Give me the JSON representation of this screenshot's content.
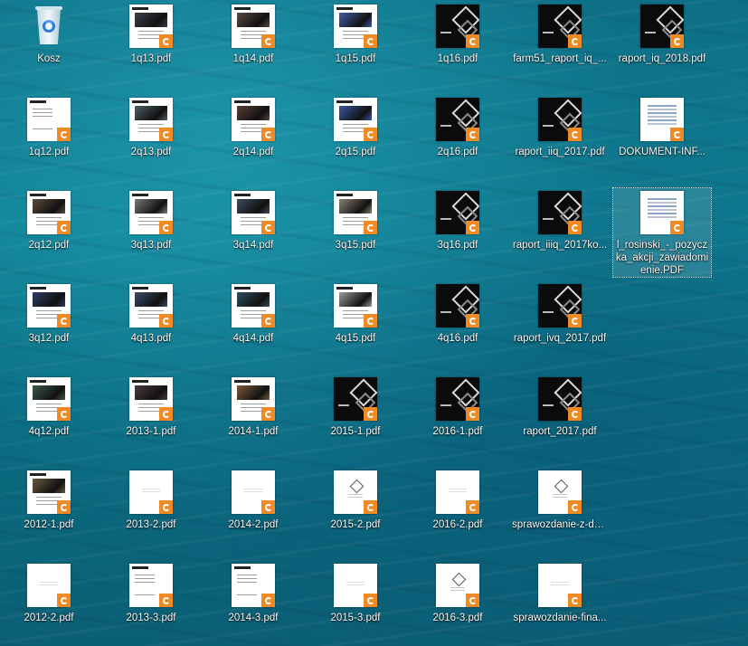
{
  "desktop": {
    "icons": [
      {
        "label": "Kosz",
        "kind": "recycle-bin",
        "col": 0,
        "row": 0
      },
      {
        "label": "1q13.pdf",
        "kind": "photo",
        "tone": "#3a3f4a",
        "col": 1,
        "row": 0
      },
      {
        "label": "1q14.pdf",
        "kind": "photo",
        "tone": "#5a4a42",
        "col": 2,
        "row": 0
      },
      {
        "label": "1q15.pdf",
        "kind": "photo",
        "tone": "#3f5fa8",
        "col": 3,
        "row": 0
      },
      {
        "label": "1q16.pdf",
        "kind": "dark",
        "col": 4,
        "row": 0
      },
      {
        "label": "farm51_raport_iq_...",
        "kind": "dark",
        "col": 5,
        "row": 0
      },
      {
        "label": "raport_iq_2018.pdf",
        "kind": "dark",
        "col": 6,
        "row": 0
      },
      {
        "label": "1q12.pdf",
        "kind": "text",
        "col": 0,
        "row": 1
      },
      {
        "label": "2q13.pdf",
        "kind": "photo",
        "tone": "#4f5e66",
        "col": 1,
        "row": 1
      },
      {
        "label": "2q14.pdf",
        "kind": "photo",
        "tone": "#5b3e36",
        "col": 2,
        "row": 1
      },
      {
        "label": "2q15.pdf",
        "kind": "photo",
        "tone": "#3a56a0",
        "col": 3,
        "row": 1
      },
      {
        "label": "2q16.pdf",
        "kind": "dark",
        "col": 4,
        "row": 1
      },
      {
        "label": "raport_iiq_2017.pdf",
        "kind": "dark",
        "col": 5,
        "row": 1
      },
      {
        "label": "DOKUMENT-INF...",
        "kind": "doc",
        "col": 6,
        "row": 1
      },
      {
        "label": "2q12.pdf",
        "kind": "photo",
        "tone": "#5c4b3a",
        "col": 0,
        "row": 2
      },
      {
        "label": "3q13.pdf",
        "kind": "photo",
        "tone": "#7a7a7a",
        "col": 1,
        "row": 2
      },
      {
        "label": "3q14.pdf",
        "kind": "photo",
        "tone": "#3e4a5a",
        "col": 2,
        "row": 2
      },
      {
        "label": "3q15.pdf",
        "kind": "photo",
        "tone": "#8a8070",
        "col": 3,
        "row": 2
      },
      {
        "label": "3q16.pdf",
        "kind": "dark",
        "col": 4,
        "row": 2
      },
      {
        "label": "raport_iiiq_2017ko...",
        "kind": "dark",
        "col": 5,
        "row": 2
      },
      {
        "label": "l_rosinski_-_pozyczka_akcji_zawiadomienie.PDF",
        "kind": "doc",
        "col": 6,
        "row": 2,
        "selected": true
      },
      {
        "label": "3q12.pdf",
        "kind": "photo",
        "tone": "#2e3a66",
        "col": 0,
        "row": 3
      },
      {
        "label": "4q13.pdf",
        "kind": "photo",
        "tone": "#3b4d6a",
        "col": 1,
        "row": 3
      },
      {
        "label": "4q14.pdf",
        "kind": "photo",
        "tone": "#2c4f5e",
        "col": 2,
        "row": 3
      },
      {
        "label": "4q15.pdf",
        "kind": "photo",
        "tone": "#9a9a9a",
        "col": 3,
        "row": 3
      },
      {
        "label": "4q16.pdf",
        "kind": "dark",
        "col": 4,
        "row": 3
      },
      {
        "label": "raport_ivq_2017.pdf",
        "kind": "dark",
        "col": 5,
        "row": 3
      },
      {
        "label": "4q12.pdf",
        "kind": "photo",
        "tone": "#3c5a4a",
        "col": 0,
        "row": 4
      },
      {
        "label": "2013-1.pdf",
        "kind": "photo",
        "tone": "#4a3a44",
        "col": 1,
        "row": 4
      },
      {
        "label": "2014-1.pdf",
        "kind": "photo",
        "tone": "#7a5a3a",
        "col": 2,
        "row": 4
      },
      {
        "label": "2015-1.pdf",
        "kind": "dark",
        "col": 3,
        "row": 4
      },
      {
        "label": "2016-1.pdf",
        "kind": "dark",
        "col": 4,
        "row": 4
      },
      {
        "label": "raport_2017.pdf",
        "kind": "dark",
        "col": 5,
        "row": 4
      },
      {
        "label": "2012-1.pdf",
        "kind": "photo",
        "tone": "#6a5a3c",
        "col": 0,
        "row": 5
      },
      {
        "label": "2013-2.pdf",
        "kind": "blank",
        "col": 1,
        "row": 5
      },
      {
        "label": "2014-2.pdf",
        "kind": "blank",
        "col": 2,
        "row": 5
      },
      {
        "label": "2015-2.pdf",
        "kind": "seal",
        "col": 3,
        "row": 5
      },
      {
        "label": "2016-2.pdf",
        "kind": "blank",
        "col": 4,
        "row": 5
      },
      {
        "label": "sprawozdanie-z-dz...",
        "kind": "seal",
        "col": 5,
        "row": 5
      },
      {
        "label": "2012-2.pdf",
        "kind": "blank",
        "col": 0,
        "row": 6
      },
      {
        "label": "2013-3.pdf",
        "kind": "text",
        "col": 1,
        "row": 6
      },
      {
        "label": "2014-3.pdf",
        "kind": "text",
        "col": 2,
        "row": 6
      },
      {
        "label": "2015-3.pdf",
        "kind": "blank",
        "col": 3,
        "row": 6
      },
      {
        "label": "2016-3.pdf",
        "kind": "seal",
        "col": 4,
        "row": 6
      },
      {
        "label": "sprawozdanie-fina...",
        "kind": "blank",
        "col": 5,
        "row": 6
      }
    ]
  },
  "colors": {
    "pdf_badge": "#f08a24",
    "selection_outline": "#ffffff"
  },
  "icon_names": {
    "recycle-bin": "recycle-bin-icon",
    "pdf": "pdf-file-icon",
    "badge": "foxit-reader-badge-icon"
  }
}
